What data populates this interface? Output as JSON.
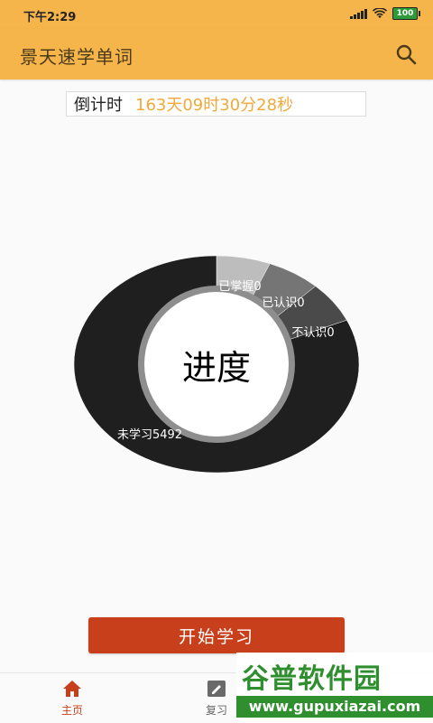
{
  "status_bar": {
    "time": "下午2:29",
    "battery": "100"
  },
  "app_bar": {
    "title": "景天速学单词",
    "search_icon": "search-icon"
  },
  "countdown": {
    "label": "倒计时",
    "value": "163天09时30分28秒",
    "value_color": "#f1a93c"
  },
  "chart_data": {
    "type": "pie",
    "center_label": "进度",
    "segments": [
      {
        "label": "已掌握",
        "value": 0,
        "text": "已掌握0",
        "color": "#bdbdbd"
      },
      {
        "label": "已认识",
        "value": 0,
        "text": "已认识0",
        "color": "#757575"
      },
      {
        "label": "不认识",
        "value": 0,
        "text": "不认识0",
        "color": "#4a4a4a"
      },
      {
        "label": "未学习",
        "value": 5492,
        "text": "未学习5492",
        "color": "#1f1f1f"
      }
    ]
  },
  "actions": {
    "start_label": "开始学习",
    "start_color": "#c8401b"
  },
  "bottom_nav": {
    "items": [
      {
        "label": "主页",
        "icon": "home-icon",
        "active": true
      },
      {
        "label": "复习",
        "icon": "pencil-icon",
        "active": false
      }
    ]
  },
  "watermark": {
    "brand": "谷普软件园",
    "url": "www.gupuxiazai.com"
  },
  "colors": {
    "accent": "#f5b54a",
    "primary_action": "#c8401b"
  }
}
